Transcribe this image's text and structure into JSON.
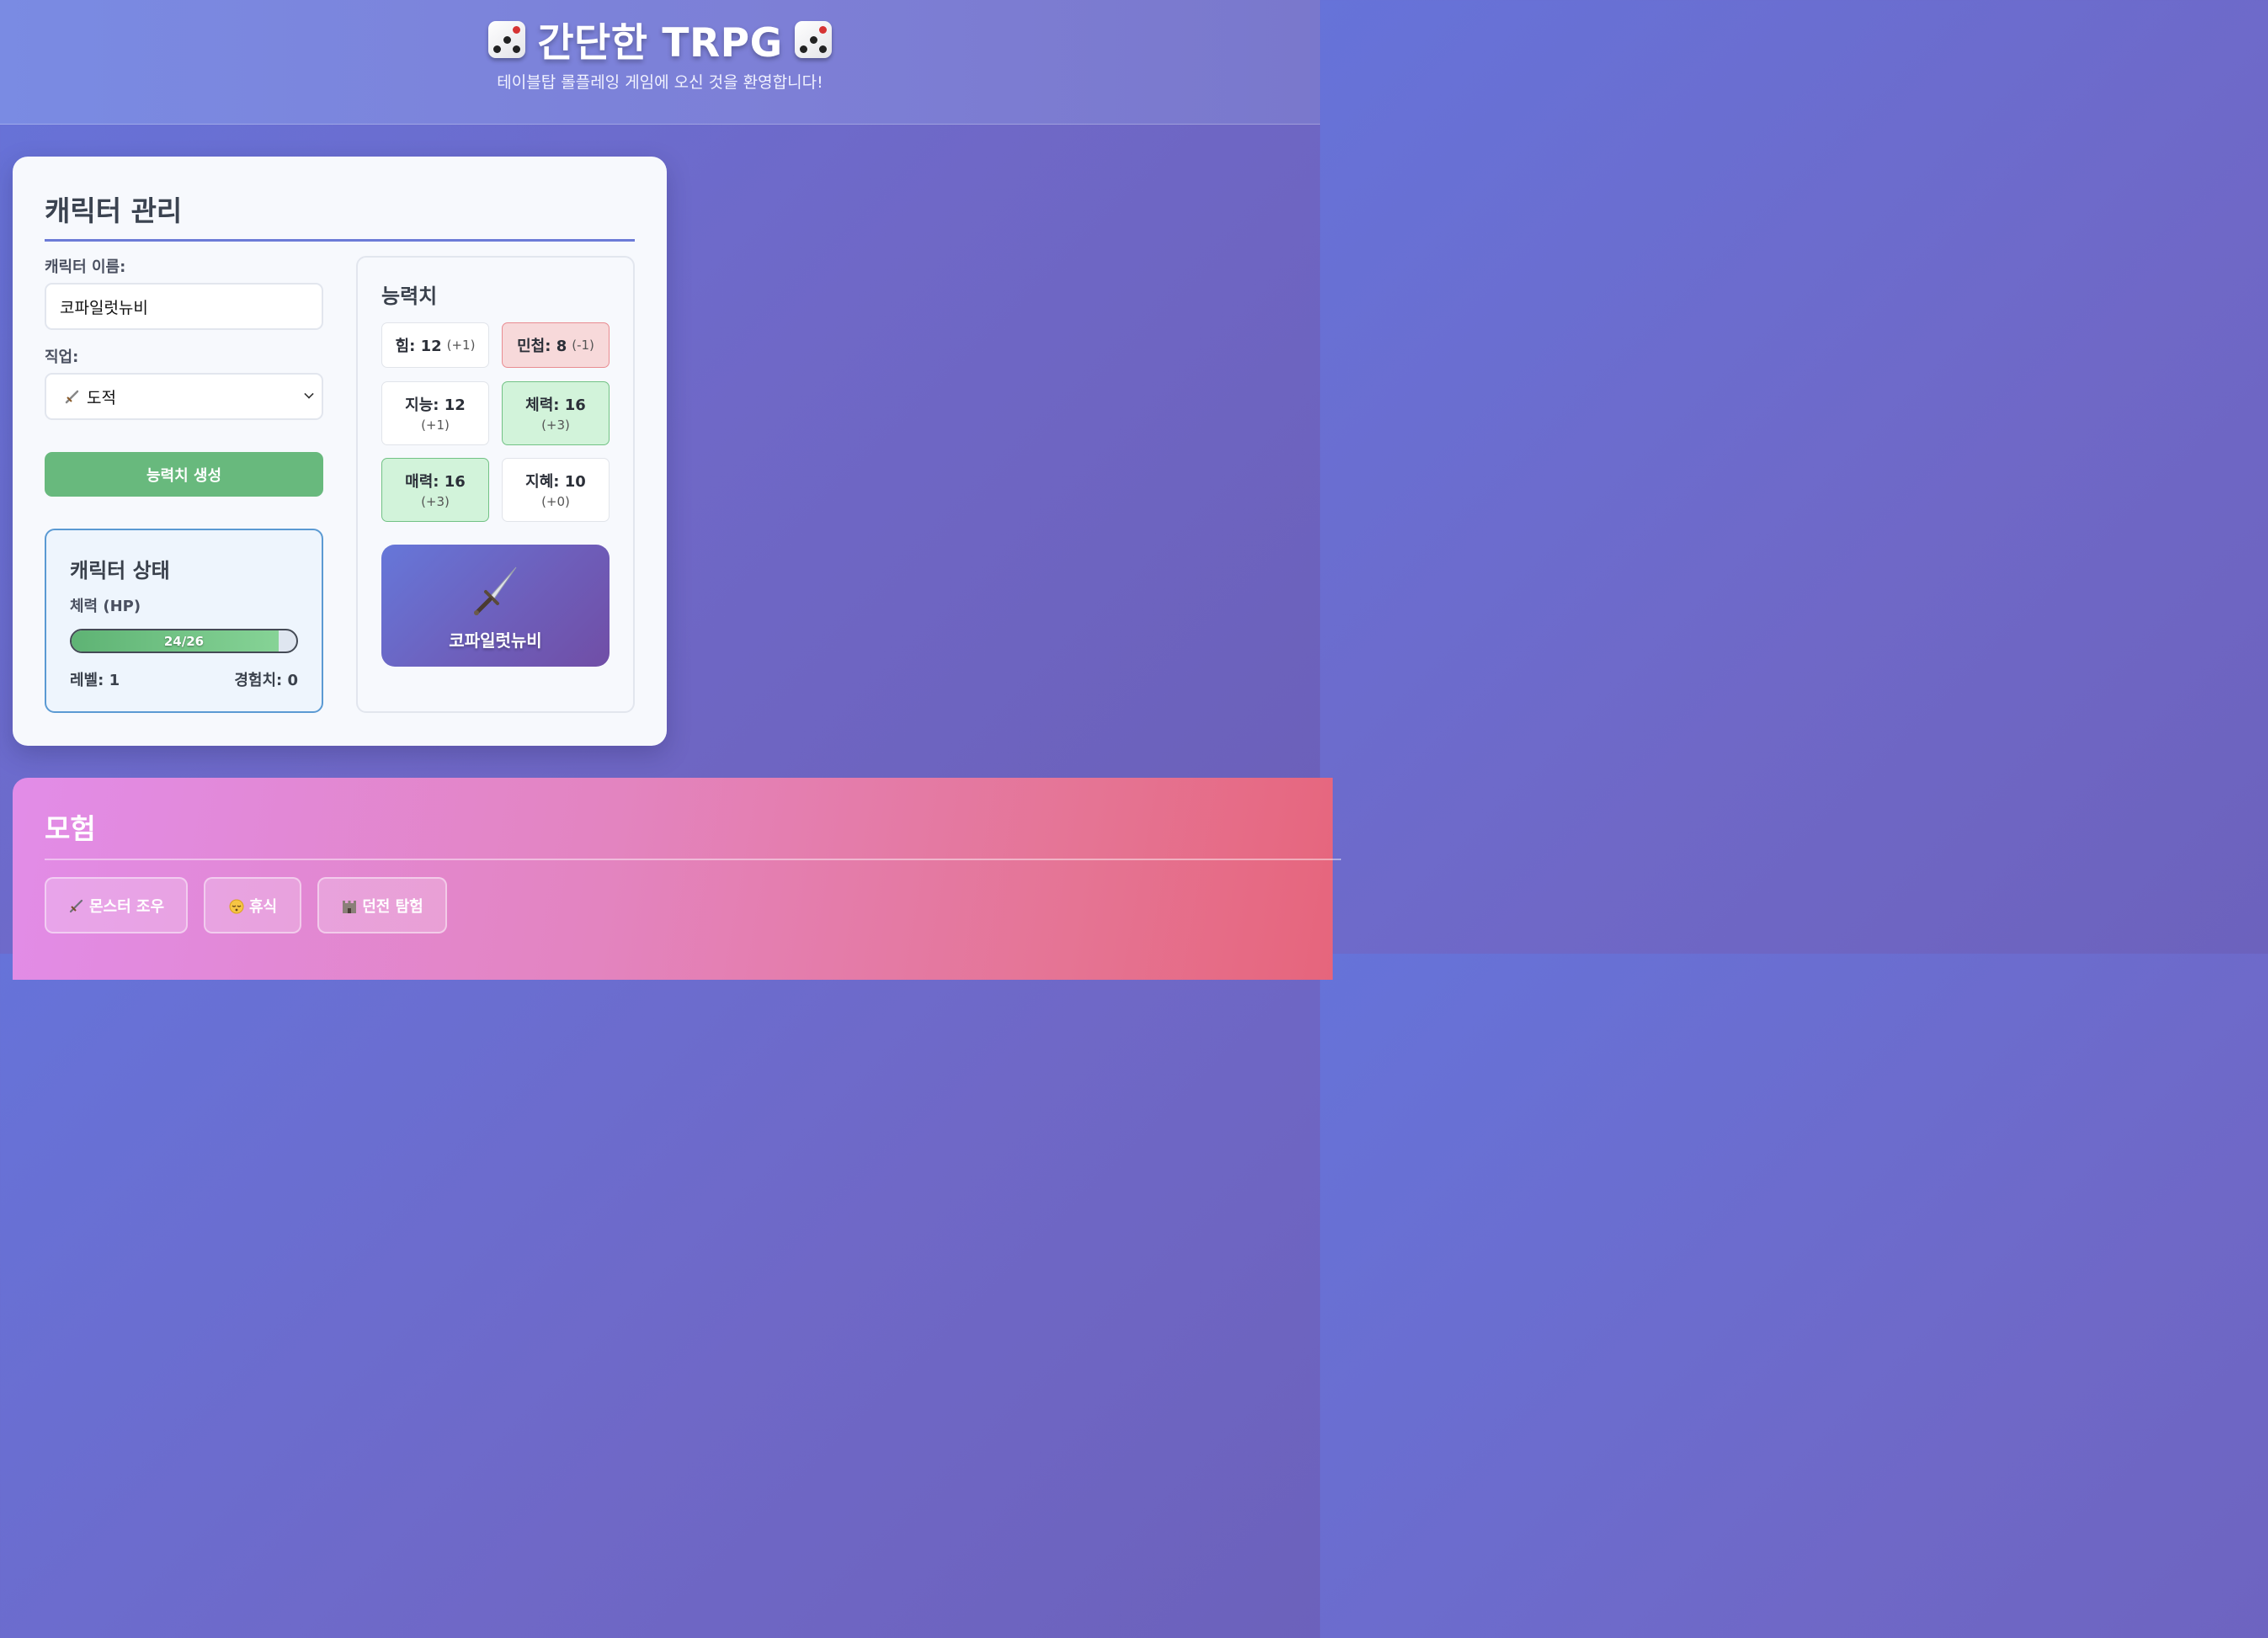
{
  "header": {
    "title": "간단한 TRPG",
    "subtitle": "테이블탑 롤플레잉 게임에 오신 것을 환영합니다!",
    "icon": "dice-icon"
  },
  "character": {
    "title": "캐릭터 관리",
    "name_label": "캐릭터 이름:",
    "name_value": "코파일럿뉴비",
    "job_label": "직업:",
    "job_value": "도적",
    "job_icon": "dagger-icon",
    "generate_button": "능력치 생성",
    "status": {
      "title": "캐릭터 상태",
      "hp_label": "체력 (HP)",
      "hp_text": "24/26",
      "hp_fraction": 0.923,
      "level": "레벨: 1",
      "exp": "경험치: 0"
    },
    "stats": {
      "title": "능력치",
      "items": [
        {
          "name": "힘: 12",
          "mod": "(+1)",
          "state": "normal"
        },
        {
          "name": "민첩: 8",
          "mod": "(-1)",
          "state": "negative"
        },
        {
          "name": "지능: 12",
          "mod": "(+1)",
          "state": "normal"
        },
        {
          "name": "체력: 16",
          "mod": "(+3)",
          "state": "positive"
        },
        {
          "name": "매력: 16",
          "mod": "(+3)",
          "state": "positive"
        },
        {
          "name": "지혜: 10",
          "mod": "(+0)",
          "state": "normal"
        }
      ]
    },
    "portrait": {
      "icon": "dagger-icon",
      "name": "코파일럿뉴비"
    }
  },
  "adventure": {
    "title": "모험",
    "buttons": [
      {
        "label": "몬스터 조우",
        "icon": "dagger-icon"
      },
      {
        "label": "휴식",
        "icon": "sleeping-face-icon"
      },
      {
        "label": "던전 탐험",
        "icon": "castle-icon"
      }
    ]
  },
  "colors": {
    "accent": "#6c7bd7",
    "generate_button": "#68b97d",
    "status_border": "#5b9ad3",
    "stat_negative": "#f7d9da",
    "stat_positive": "#d2f3da"
  }
}
